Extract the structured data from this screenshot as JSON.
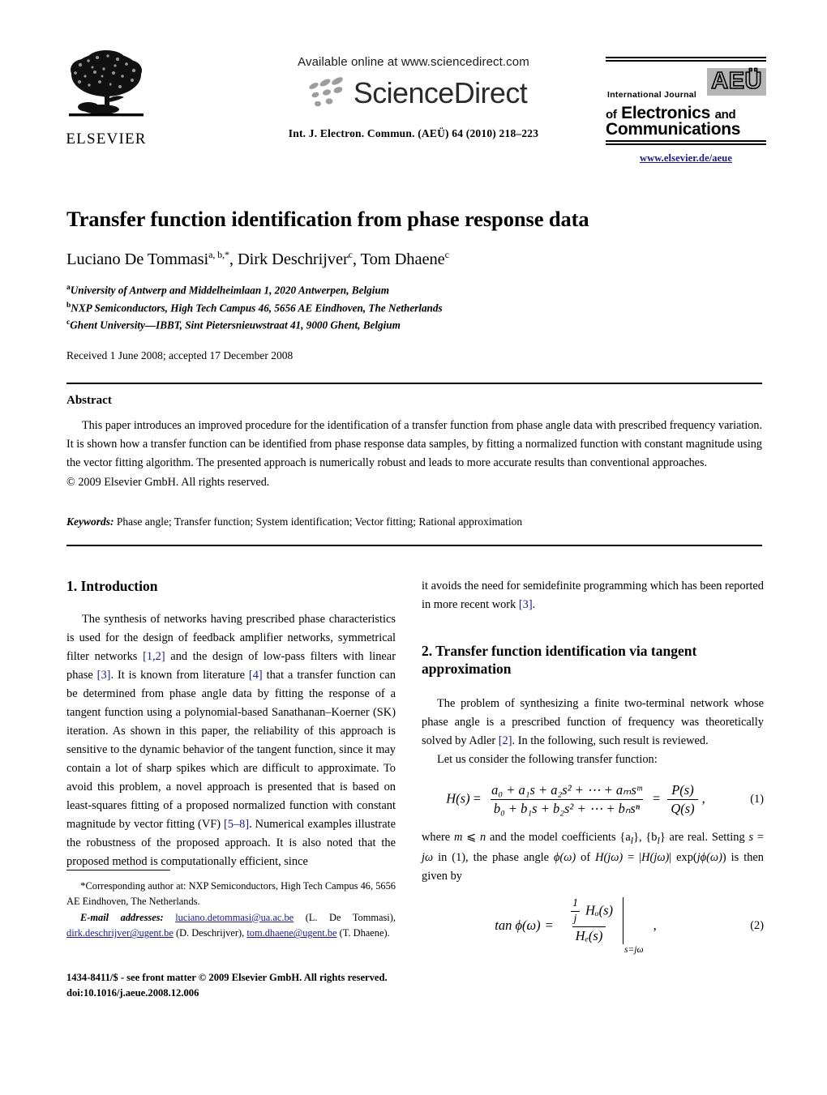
{
  "masthead": {
    "elsevier_wordmark": "ELSEVIER",
    "available_online": "Available online at www.sciencedirect.com",
    "sciencedirect_wordmark": "ScienceDirect",
    "journal_citation": "Int. J. Electron. Commun. (AEÜ) 64 (2010) 218–223",
    "aeu_badge": "AEÜ",
    "aeu_international_journal": "International Journal",
    "aeu_line2_lead": "of",
    "aeu_line2_main": "Electronics",
    "aeu_line2_tail": "and",
    "aeu_line3": "Communications",
    "publisher_url": "www.elsevier.de/aeue"
  },
  "article": {
    "title": "Transfer function identification from phase response data",
    "authors": "Luciano De Tommasi",
    "author_sup_1": "a, b,*",
    "author_2": ", Dirk Deschrijver",
    "author_sup_2": "c",
    "author_3": ", Tom Dhaene",
    "author_sup_3": "c",
    "affiliations": [
      {
        "marker": "a",
        "text": "University of Antwerp and Middelheimlaan 1, 2020 Antwerpen, Belgium"
      },
      {
        "marker": "b",
        "text": "NXP Semiconductors, High Tech Campus 46, 5656 AE Eindhoven, The Netherlands"
      },
      {
        "marker": "c",
        "text": "Ghent University—IBBT, Sint Pietersnieuwstraat 41, 9000 Ghent, Belgium"
      }
    ],
    "history": "Received 1 June 2008; accepted 17 December 2008"
  },
  "abstract": {
    "heading": "Abstract",
    "text": "This paper introduces an improved procedure for the identification of a transfer function from phase angle data with prescribed frequency variation. It is shown how a transfer function can be identified from phase response data samples, by fitting a normalized function with constant magnitude using the vector fitting algorithm. The presented approach is numerically robust and leads to more accurate results than conventional approaches.",
    "copyright": "© 2009 Elsevier GmbH. All rights reserved.",
    "keywords_label": "Keywords:",
    "keywords_value": "Phase angle; Transfer function; System identification; Vector fitting; Rational approximation"
  },
  "sections": {
    "intro_heading": "1. Introduction",
    "intro_p1_a": "The synthesis of networks having prescribed phase characteristics is used for the design of feedback amplifier networks, symmetrical filter networks ",
    "intro_ref_12": "[1,2]",
    "intro_p1_b": " and the design of low-pass filters with linear phase ",
    "intro_ref_3": "[3]",
    "intro_p1_c": ". It is known from literature ",
    "intro_ref_4": "[4]",
    "intro_p1_d": " that a transfer function can be determined from phase angle data by fitting the response of a tangent function using a polynomial-based Sanathanan–Koerner (SK) iteration. As shown in this paper, the reliability of this approach is sensitive to the dynamic behavior of the tangent function, since it may contain a lot of sharp spikes which are difficult to approximate. To avoid this problem, a novel approach is presented that is based on least-squares fitting of a proposed normalized function with constant magnitude by vector fitting (VF) ",
    "intro_ref_58": "[5–8]",
    "intro_p1_e": ". Numerical examples illustrate the robustness of the proposed approach. It is also noted that the proposed method is computationally efficient, since",
    "right_cont_a": "it avoids the need for semidefinite programming which has been reported in more recent work ",
    "right_cont_ref": "[3]",
    "right_cont_b": ".",
    "sec2_heading": "2. Transfer function identification via tangent approximation",
    "sec2_p1_a": "The problem of synthesizing a finite two-terminal network whose phase angle is a prescribed function of frequency was theoretically solved by Adler ",
    "sec2_ref_2": "[2]",
    "sec2_p1_b": ". In the following, such result is reviewed.",
    "sec2_p2": "Let us consider the following transfer function:",
    "after_eq1_a": "where ",
    "after_eq1_m": "m",
    "after_eq1_le": " ⩽ ",
    "after_eq1_n": "n",
    "after_eq1_b": " and the model coefficients {a",
    "after_eq1_sub1": "l",
    "after_eq1_c": "}, {b",
    "after_eq1_sub2": "l",
    "after_eq1_d": "} are real. Setting ",
    "after_eq1_s": "s",
    "after_eq1_eq": " = ",
    "after_eq1_jw": "jω",
    "after_eq1_e": " in (1), the phase angle ",
    "after_eq1_phi": "ϕ(ω)",
    "after_eq1_f": " of ",
    "after_eq1_hjw": "H(jω)",
    "after_eq1_g": " = |",
    "after_eq1_hjw2": "H(jω)",
    "after_eq1_h": "| exp(",
    "after_eq1_jphi": "jϕ(ω)",
    "after_eq1_i": ") is then given by"
  },
  "equations": {
    "eq1": {
      "number": "(1)",
      "lhs": "H(s)",
      "eq": "=",
      "numerator": "a₀ + a₁s + a₂s² + ⋯ + aₘsᵐ",
      "denominator": "b₀ + b₁s + b₂s² + ⋯ + bₙsⁿ",
      "eq2sign": "=",
      "rhs_num": "P(s)",
      "rhs_den": "Q(s)",
      "trailing": ","
    },
    "eq2": {
      "number": "(2)",
      "lhs": "tan ϕ(ω)",
      "eq": "=",
      "inner_num_frac_num": "1",
      "inner_num_frac_den": "j",
      "inner_num_rest": "Hₒ(s)",
      "outer_den": "Hₑ(s)",
      "evaluated_at": "s=jω",
      "trailing": ","
    }
  },
  "footnote": {
    "star": "*",
    "corresponding": "Corresponding author at: NXP Semiconductors, High Tech Campus 46, 5656 AE Eindhoven, The Netherlands.",
    "email_label": "E-mail addresses:",
    "email_1": "luciano.detommasi@ua.ac.be",
    "email_1_name": " (L. De Tommasi), ",
    "email_2": "dirk.deschrijver@ugent.be",
    "email_2_name": " (D. Deschrijver), ",
    "email_3": "tom.dhaene@ugent.be",
    "email_3_name": " (T. Dhaene)."
  },
  "imprint": {
    "line1": "1434-8411/$ - see front matter © 2009 Elsevier GmbH. All rights reserved.",
    "line2": "doi:10.1016/j.aeue.2008.12.006"
  },
  "colors": {
    "link_blue": "#1a1a8c",
    "aeu_gray": "#b5b5b5"
  }
}
